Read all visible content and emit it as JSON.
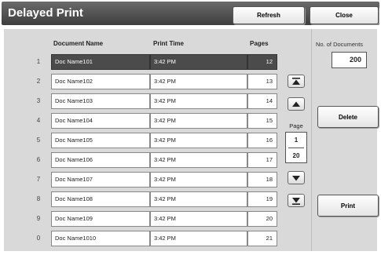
{
  "header": {
    "title": "Delayed Print",
    "refresh_label": "Refresh",
    "close_label": "Close"
  },
  "table": {
    "columns": {
      "document_name": "Document Name",
      "print_time": "Print Time",
      "pages": "Pages"
    },
    "rows": [
      {
        "index": "1",
        "name": "Doc Name101",
        "time": "3:42 PM",
        "pages": "12",
        "selected": true
      },
      {
        "index": "2",
        "name": "Doc Name102",
        "time": "3:42 PM",
        "pages": "13",
        "selected": false
      },
      {
        "index": "3",
        "name": "Doc Name103",
        "time": "3:42 PM",
        "pages": "14",
        "selected": false
      },
      {
        "index": "4",
        "name": "Doc Name104",
        "time": "3:42 PM",
        "pages": "15",
        "selected": false
      },
      {
        "index": "5",
        "name": "Doc Name105",
        "time": "3:42 PM",
        "pages": "16",
        "selected": false
      },
      {
        "index": "6",
        "name": "Doc Name106",
        "time": "3:42 PM",
        "pages": "17",
        "selected": false
      },
      {
        "index": "7",
        "name": "Doc Name107",
        "time": "3:42 PM",
        "pages": "18",
        "selected": false
      },
      {
        "index": "8",
        "name": "Doc Name108",
        "time": "3:42 PM",
        "pages": "19",
        "selected": false
      },
      {
        "index": "9",
        "name": "Doc Name109",
        "time": "3:42 PM",
        "pages": "20",
        "selected": false
      },
      {
        "index": "0",
        "name": "Doc Name1010",
        "time": "3:42 PM",
        "pages": "21",
        "selected": false
      }
    ]
  },
  "pager": {
    "label": "Page",
    "current": "1",
    "total": "20"
  },
  "side": {
    "docs_label": "No. of Documents",
    "docs_count": "200",
    "delete_label": "Delete",
    "print_label": "Print"
  },
  "icons": {
    "top": "first-page-icon",
    "up": "page-up-icon",
    "down": "page-down-icon",
    "bottom": "last-page-icon"
  },
  "colors": {
    "title_bar": "#4a4a4a",
    "panel": "#d9d9d9",
    "selected_row": "#4b4b4b"
  }
}
